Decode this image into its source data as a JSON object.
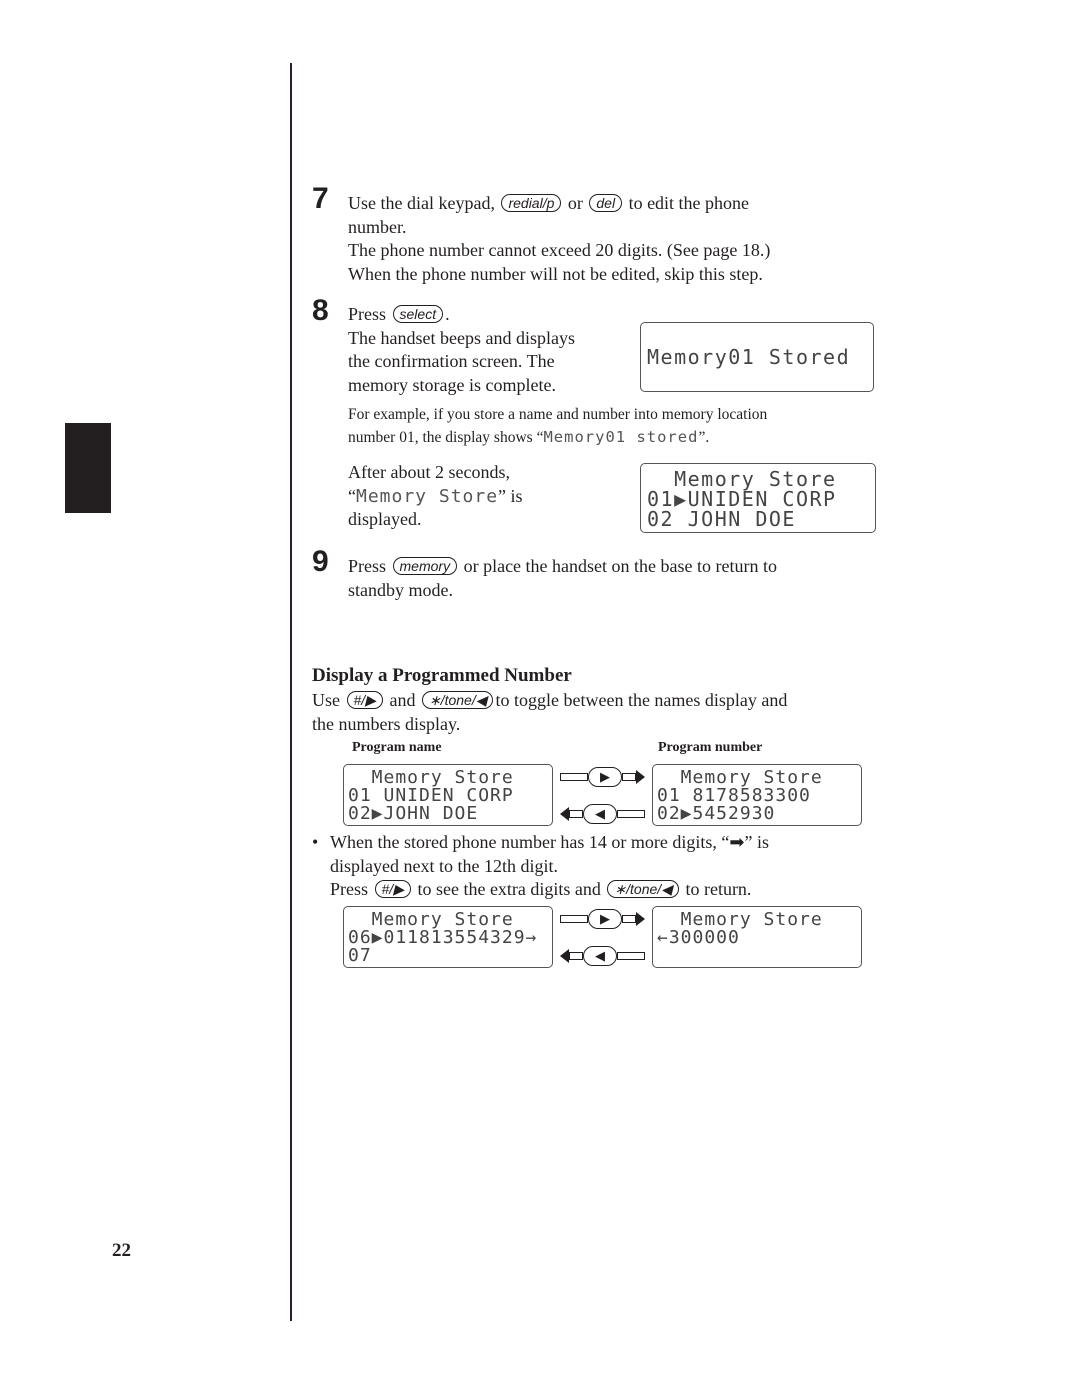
{
  "page_number": "22",
  "step7": {
    "number": "7",
    "line1_pre": "Use the dial keypad,",
    "key1": "redial/p",
    "line1_mid": "or",
    "key2": "del",
    "line1_post": "to edit the phone",
    "line2": "number.",
    "line3": "The phone number cannot exceed 20 digits. (See page 18.)",
    "line4": "When the phone number will not be edited, skip this step."
  },
  "step8": {
    "number": "8",
    "press": "Press",
    "key": "select",
    "period": ".",
    "desc": [
      "The handset beeps and displays",
      "the confirmation screen. The",
      "memory storage is complete."
    ],
    "lcd": [
      "Memory01 Stored"
    ],
    "example_line1": "For example, if you store a name and number into memory location",
    "example_line2_pre": "number 01, the display shows “",
    "example_lcd": "Memory01 stored",
    "example_line2_post": "”.",
    "after_line1": "After about 2 seconds,",
    "after_lcd": "Memory Store",
    "after_line2_open": "“",
    "after_line2_post": "” is",
    "after_line3": "displayed.",
    "lcd2": [
      "  Memory Store",
      "01▶UNIDEN CORP",
      "02 JOHN DOE"
    ]
  },
  "step9": {
    "number": "9",
    "press": "Press",
    "key": "memory",
    "post": "or place the handset on the base to return to",
    "line2": "standby mode."
  },
  "section": {
    "title": "Display a Programmed Number",
    "line1_pre": "Use",
    "key_next": "#/▶",
    "and": "and",
    "key_prev": "∗/tone/◀",
    "line1_post": "to toggle between the names display and",
    "line2": "the numbers display.",
    "col_name": "Program name",
    "col_number": "Program number",
    "lcd_name": [
      "  Memory Store",
      "01 UNIDEN CORP",
      "02▶JOHN DOE"
    ],
    "lcd_number": [
      "  Memory Store",
      "01 8178583300",
      "02▶5452930"
    ],
    "bullet": "•",
    "note_line1_pre": "When the stored phone number has 14 or more digits, “",
    "note_arrow": "➡",
    "note_line1_post": "” is",
    "note_line2": "displayed next to the 12th digit.",
    "note_line3_pre": "Press",
    "note_line3_mid": "to see the extra digits and",
    "note_line3_post": "to return.",
    "lcd_long": [
      "  Memory Store",
      "06▶011813554329→",
      "07"
    ],
    "lcd_extra": [
      "  Memory Store",
      "←300000",
      ""
    ],
    "nav_next": "▶",
    "nav_prev": "◀"
  }
}
